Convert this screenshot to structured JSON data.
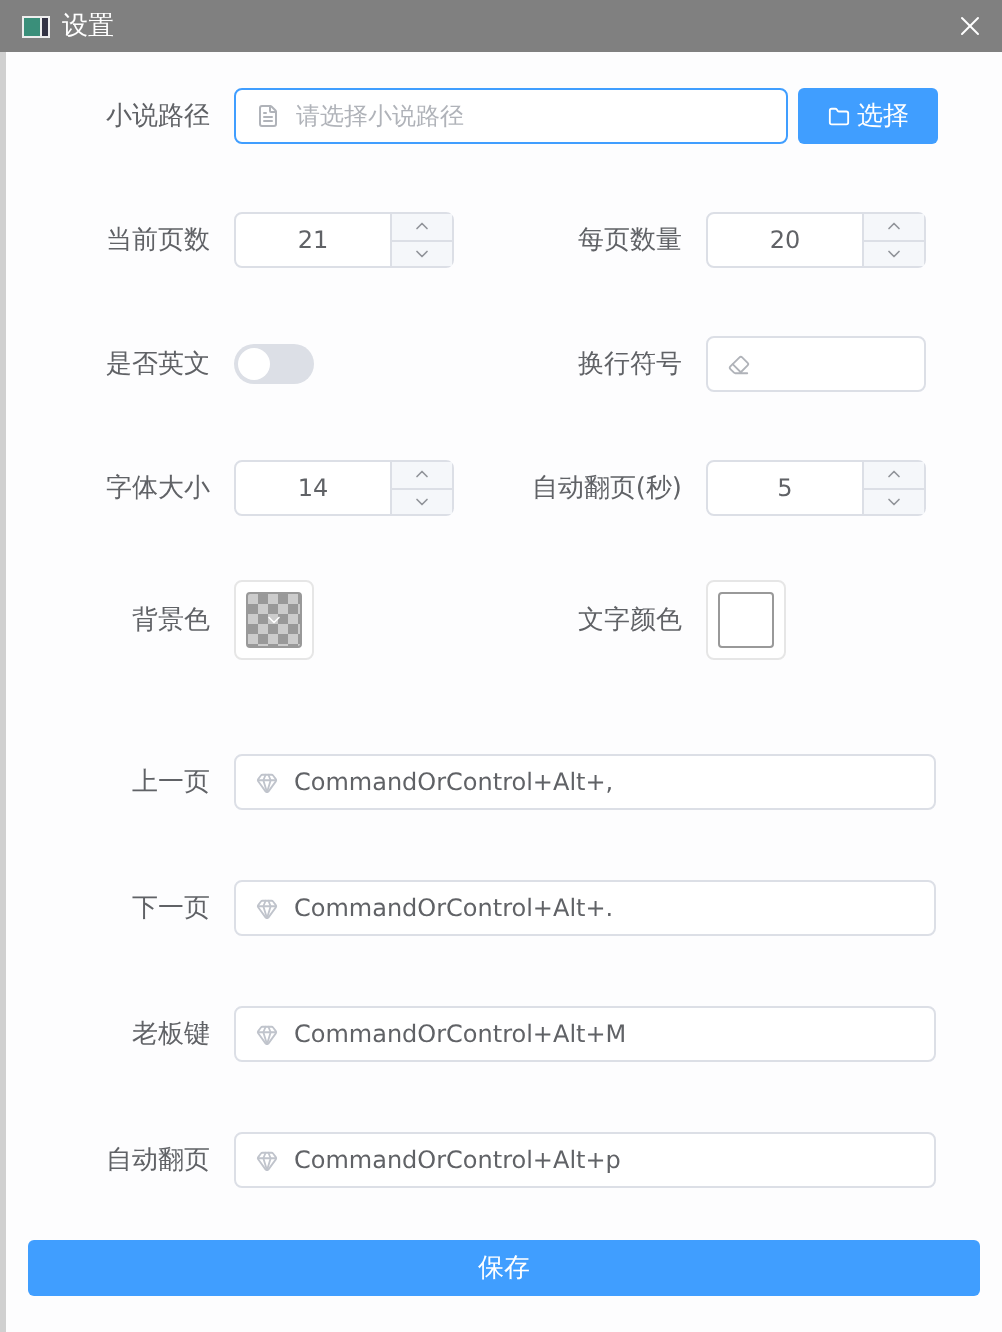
{
  "window": {
    "title": "设置"
  },
  "novel_path": {
    "label": "小说路径",
    "placeholder": "请选择小说路径",
    "button": "选择"
  },
  "number_rows": [
    {
      "left": {
        "label": "当前页数",
        "value": "21"
      },
      "right": {
        "label": "每页数量",
        "value": "20"
      }
    }
  ],
  "english": {
    "label": "是否英文",
    "on": false
  },
  "line_break": {
    "label": "换行符号"
  },
  "number_rows_2": [
    {
      "left": {
        "label": "字体大小",
        "value": "14"
      },
      "right": {
        "label": "自动翻页(秒)",
        "value": "5"
      }
    }
  ],
  "colors": [
    {
      "label": "背景色",
      "kind": "empty"
    },
    {
      "label": "文字颜色",
      "kind": "solid",
      "color": "#ffffff"
    }
  ],
  "shortcuts": [
    {
      "label": "上一页",
      "value": "CommandOrControl+Alt+,"
    },
    {
      "label": "下一页",
      "value": "CommandOrControl+Alt+."
    },
    {
      "label": "老板键",
      "value": "CommandOrControl+Alt+M"
    },
    {
      "label": "自动翻页",
      "value": "CommandOrControl+Alt+p"
    }
  ],
  "save_button": "保存"
}
